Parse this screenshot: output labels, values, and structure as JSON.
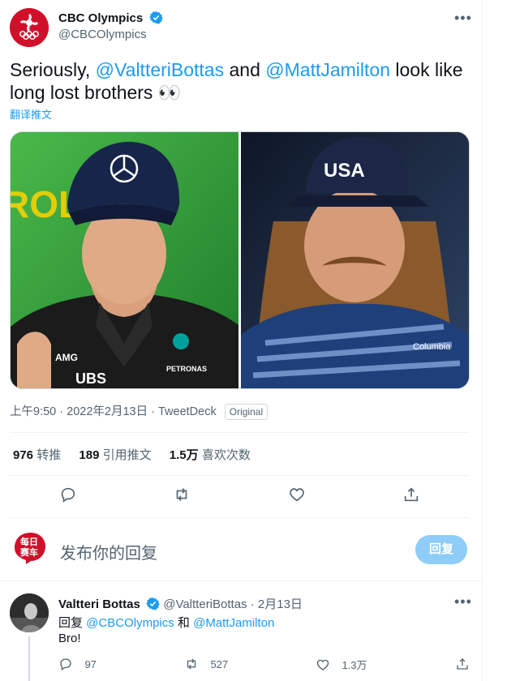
{
  "tweet": {
    "author": {
      "name": "CBC Olympics",
      "handle": "@CBCOlympics"
    },
    "more_icon": "more-dots-icon",
    "text_parts": {
      "t1": "Seriously, ",
      "m1": "@ValtteriBottas",
      "t2": " and ",
      "m2": "@MattJamilton",
      "t3": " look like long lost brothers 👀"
    },
    "translate_label": "翻译推文",
    "media": {
      "left_text": {
        "team_logo": "AMG",
        "sponsor": "UBS",
        "team": "PETRONAS",
        "bg_word": "ROL"
      },
      "right_text": {
        "cap": "USA",
        "brand": "Columbia"
      }
    },
    "meta": {
      "time": "上午9:50",
      "sep": "·",
      "date": "2022年2月13日",
      "source": "TweetDeck",
      "badge": "Original"
    },
    "stats": [
      {
        "value": "976",
        "label": "转推"
      },
      {
        "value": "189",
        "label": "引用推文"
      },
      {
        "value": "1.5万",
        "label": "喜欢次数"
      }
    ],
    "actions": [
      "reply-icon",
      "retweet-icon",
      "like-icon",
      "share-icon"
    ]
  },
  "composer": {
    "avatar_text": {
      "line1": "每日",
      "line2": "赛车"
    },
    "placeholder": "发布你的回复",
    "button_label": "回复"
  },
  "reply": {
    "author": {
      "name": "Valtteri Bottas",
      "handle": "@ValtteriBottas",
      "sep": "·",
      "date": "2月13日"
    },
    "replying_prefix": "回复 ",
    "replying_to_1": "@CBCOlympics",
    "replying_and": " 和 ",
    "replying_to_2": "@MattJamilton",
    "text": "Bro!",
    "stats": {
      "replies": "97",
      "retweets": "527",
      "likes": "1.3万"
    }
  },
  "colors": {
    "accent": "#1d9bf0",
    "cbc_red": "#d0102a",
    "text": "#0f1419",
    "muted": "#536471"
  }
}
